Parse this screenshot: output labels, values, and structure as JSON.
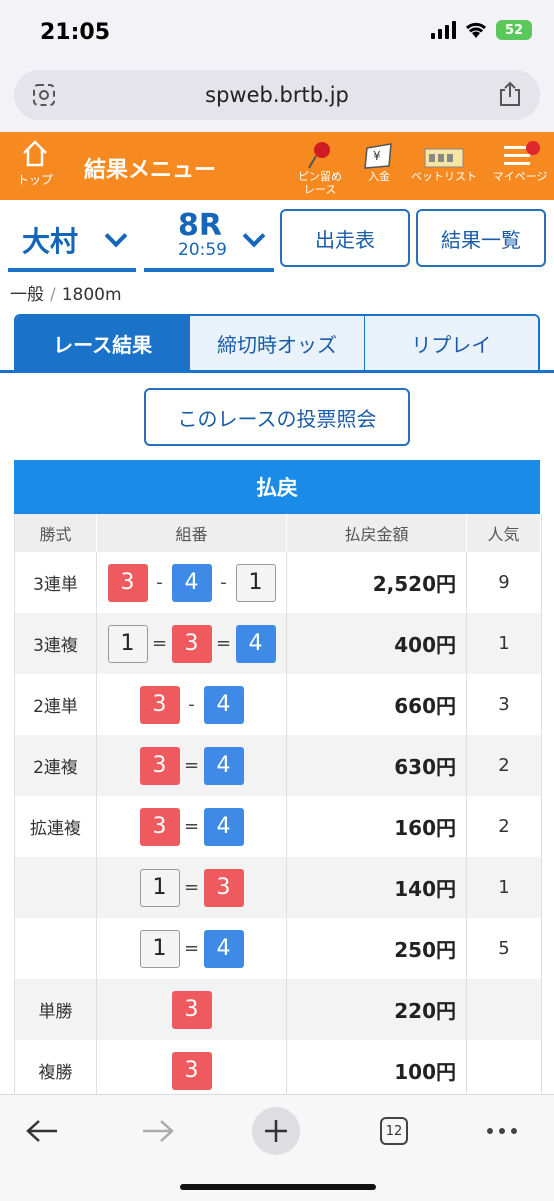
{
  "status": {
    "time": "21:05",
    "battery": "52"
  },
  "browser": {
    "url": "spweb.brtb.jp",
    "tab_count": "12"
  },
  "appbar": {
    "home_label": "トップ",
    "title": "結果メニュー",
    "nav": [
      {
        "label1": "ピン留め",
        "label2": "レース",
        "icon": "pushpin-icon"
      },
      {
        "label1": "入金",
        "label2": "",
        "icon": "deposit-icon"
      },
      {
        "label1": "ベットリスト",
        "label2": "",
        "icon": "betlist-icon"
      },
      {
        "label1": "マイページ",
        "label2": "",
        "icon": "menu-icon"
      }
    ]
  },
  "selector": {
    "venue": "大村",
    "race": "8R",
    "race_time": "20:59"
  },
  "buttons": {
    "entries": "出走表",
    "results_list": "結果一覧",
    "vote_check": "このレースの投票照会"
  },
  "race_info": {
    "class": "一般",
    "distance": "1800m"
  },
  "tabs": [
    {
      "label": "レース結果",
      "active": true
    },
    {
      "label": "締切時オッズ",
      "active": false
    },
    {
      "label": "リプレイ",
      "active": false
    }
  ],
  "payout": {
    "title": "払戻",
    "headers": [
      "勝式",
      "組番",
      "払戻金額",
      "人気"
    ],
    "rows": [
      {
        "type": "3連単",
        "combo": [
          "3",
          "-",
          "4",
          "-",
          "1"
        ],
        "amount": "2,520円",
        "pop": "9"
      },
      {
        "type": "3連複",
        "combo": [
          "1",
          "=",
          "3",
          "=",
          "4"
        ],
        "amount": "400円",
        "pop": "1"
      },
      {
        "type": "2連単",
        "combo": [
          "3",
          "-",
          "4"
        ],
        "amount": "660円",
        "pop": "3"
      },
      {
        "type": "2連複",
        "combo": [
          "3",
          "=",
          "4"
        ],
        "amount": "630円",
        "pop": "2"
      },
      {
        "type": "拡連複",
        "combo": [
          "3",
          "=",
          "4"
        ],
        "amount": "160円",
        "pop": "2"
      },
      {
        "type": "",
        "combo": [
          "1",
          "=",
          "3"
        ],
        "amount": "140円",
        "pop": "1"
      },
      {
        "type": "",
        "combo": [
          "1",
          "=",
          "4"
        ],
        "amount": "250円",
        "pop": "5"
      },
      {
        "type": "単勝",
        "combo": [
          "3"
        ],
        "amount": "220円",
        "pop": ""
      },
      {
        "type": "複勝",
        "combo": [
          "3"
        ],
        "amount": "100円",
        "pop": ""
      }
    ]
  },
  "colors": {
    "orange": "#f6891f",
    "blue": "#1a73c9",
    "boat1": "#f4f4f4",
    "boat3": "#ef5a5f",
    "boat4": "#3f8ae6"
  }
}
